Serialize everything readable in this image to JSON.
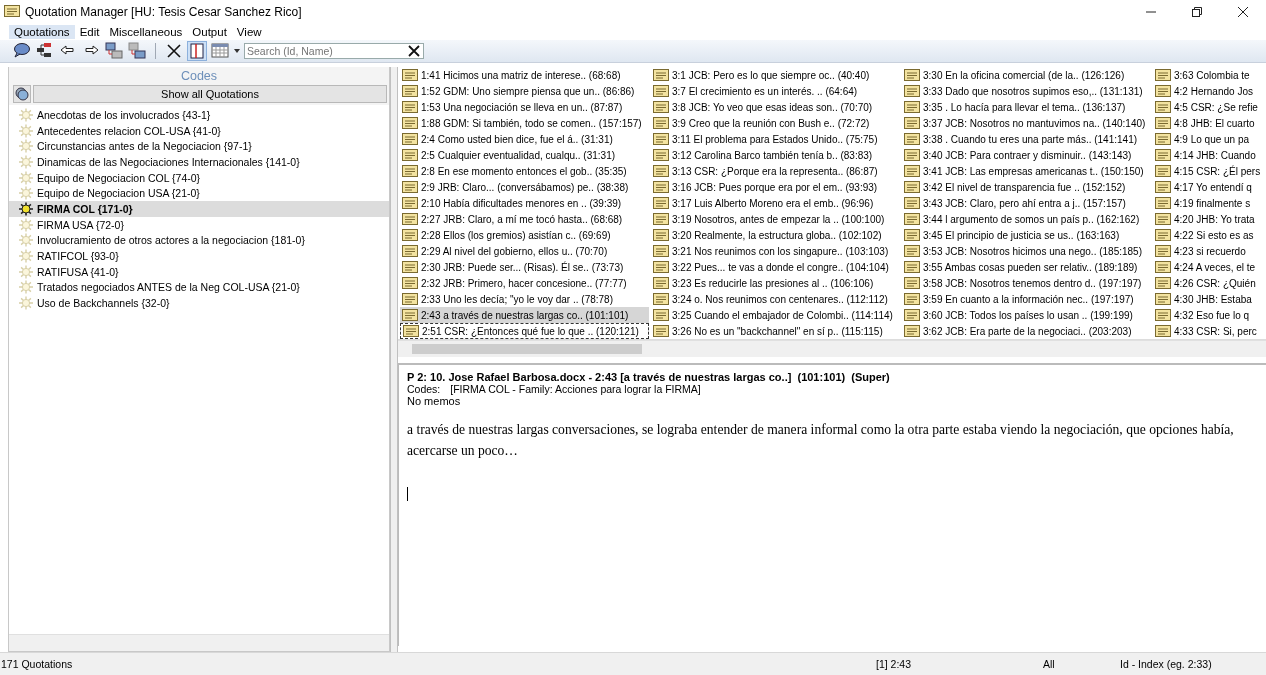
{
  "window": {
    "title": "Quotation Manager [HU: Tesis Cesar Sanchez Rico]"
  },
  "menu": [
    {
      "label": "Quotations",
      "selected": true
    },
    {
      "label": "Edit",
      "selected": false
    },
    {
      "label": "Miscellaneous",
      "selected": false
    },
    {
      "label": "Output",
      "selected": false
    },
    {
      "label": "View",
      "selected": false
    }
  ],
  "toolbar": {
    "buttons": [
      {
        "kind": "comment",
        "on": false
      },
      {
        "kind": "tree",
        "on": false
      },
      {
        "kind": "back",
        "on": false
      },
      {
        "kind": "forward",
        "on": false
      },
      {
        "kind": "window-a",
        "on": false
      },
      {
        "kind": "window-b",
        "on": false
      },
      {
        "kind": "separator"
      },
      {
        "kind": "delete",
        "on": false
      },
      {
        "kind": "columns",
        "on": true
      },
      {
        "kind": "grid",
        "on": false
      }
    ],
    "search": {
      "placeholder": "Search (Id, Name)"
    }
  },
  "codes_panel": {
    "title": "Codes",
    "show_all_button": "Show all Quotations",
    "codes": [
      {
        "label": "Anecdotas de los involucrados {43-1}",
        "selected": false
      },
      {
        "label": "Antecedentes relacion COL-USA {41-0}",
        "selected": false
      },
      {
        "label": "Circunstancias antes de la Negociacion {97-1}",
        "selected": false
      },
      {
        "label": "Dinamicas de las Negociaciones Internacionales {141-0}",
        "selected": false
      },
      {
        "label": "Equipo de Negociacion COL {74-0}",
        "selected": false
      },
      {
        "label": "Equipo de Negociacion USA {21-0}",
        "selected": false
      },
      {
        "label": "FIRMA COL {171-0}",
        "selected": true
      },
      {
        "label": "FIRMA USA {72-0}",
        "selected": false
      },
      {
        "label": "Involucramiento de otros actores a la negociacion {181-0}",
        "selected": false
      },
      {
        "label": "RATIFCOL {93-0}",
        "selected": false
      },
      {
        "label": "RATIFUSA {41-0}",
        "selected": false
      },
      {
        "label": "Tratados negociados ANTES de la Neg COL-USA {21-0}",
        "selected": false
      },
      {
        "label": "Uso de Backchannels {32-0}",
        "selected": false
      }
    ]
  },
  "quotations": {
    "columns": [
      {
        "items": [
          {
            "label": "1:41 Hicimos una matriz de interese.. (68:68)",
            "selected": false,
            "focused": false
          },
          {
            "label": "1:52 GDM: Uno siempre piensa que un.. (86:86)",
            "selected": false,
            "focused": false
          },
          {
            "label": "1:53 Una negociación se lleva en un.. (87:87)",
            "selected": false,
            "focused": false
          },
          {
            "label": "1:88 GDM: Si también, todo se comen.. (157:157)",
            "selected": false,
            "focused": false
          },
          {
            "label": "2:4 Como usted bien dice, fue el á.. (31:31)",
            "selected": false,
            "focused": false
          },
          {
            "label": "2:5 Cualquier eventualidad, cualqu.. (31:31)",
            "selected": false,
            "focused": false
          },
          {
            "label": "2:8 En ese momento entonces el gob.. (35:35)",
            "selected": false,
            "focused": false
          },
          {
            "label": "2:9 JRB: Claro... (conversábamos) pe.. (38:38)",
            "selected": false,
            "focused": false
          },
          {
            "label": "2:10 Había dificultades menores en .. (39:39)",
            "selected": false,
            "focused": false
          },
          {
            "label": "2:27 JRB: Claro, a mí me tocó hasta.. (68:68)",
            "selected": false,
            "focused": false
          },
          {
            "label": "2:28 Ellos (los gremios) asistían c.. (69:69)",
            "selected": false,
            "focused": false
          },
          {
            "label": "2:29 Al nivel del gobierno, ellos u.. (70:70)",
            "selected": false,
            "focused": false
          },
          {
            "label": "2:30 JRB: Puede ser... (Risas). Él se.. (73:73)",
            "selected": false,
            "focused": false
          },
          {
            "label": "2:32 JRB: Primero, hacer concesione.. (77:77)",
            "selected": false,
            "focused": false
          },
          {
            "label": "2:33 Uno les decía; \"yo le voy dar .. (78:78)",
            "selected": false,
            "focused": false
          },
          {
            "label": "2:43 a través de nuestras largas co.. (101:101)",
            "selected": true,
            "focused": false
          },
          {
            "label": "2:51 CSR: ¿Entonces qué fue lo que .. (120:121)",
            "selected": false,
            "focused": true
          }
        ]
      },
      {
        "items": [
          {
            "label": "3:1 JCB: Pero es lo que siempre oc.. (40:40)",
            "selected": false,
            "focused": false
          },
          {
            "label": "3:7 El crecimiento es un interés. .. (64:64)",
            "selected": false,
            "focused": false
          },
          {
            "label": "3:8 JCB: Yo veo que esas ideas son.. (70:70)",
            "selected": false,
            "focused": false
          },
          {
            "label": "3:9 Creo que la reunión con Bush e.. (72:72)",
            "selected": false,
            "focused": false
          },
          {
            "label": "3:11 El problema para Estados Unido.. (75:75)",
            "selected": false,
            "focused": false
          },
          {
            "label": "3:12 Carolina Barco también tenía b.. (83:83)",
            "selected": false,
            "focused": false
          },
          {
            "label": "3:13 CSR: ¿Porque era la representa.. (86:87)",
            "selected": false,
            "focused": false
          },
          {
            "label": "3:16 JCB: Pues porque era por el em.. (93:93)",
            "selected": false,
            "focused": false
          },
          {
            "label": "3:17 Luis Alberto Moreno era el emb.. (96:96)",
            "selected": false,
            "focused": false
          },
          {
            "label": "3:19 Nosotros, antes de empezar la .. (100:100)",
            "selected": false,
            "focused": false
          },
          {
            "label": "3:20 Realmente, la estructura globa.. (102:102)",
            "selected": false,
            "focused": false
          },
          {
            "label": "3:21 Nos reunimos con los singapure.. (103:103)",
            "selected": false,
            "focused": false
          },
          {
            "label": "3:22 Pues... te vas a donde el congre.. (104:104)",
            "selected": false,
            "focused": false
          },
          {
            "label": "3:23 Es reducirle las presiones al .. (106:106)",
            "selected": false,
            "focused": false
          },
          {
            "label": "3:24 o. Nos reunimos con centenares.. (112:112)",
            "selected": false,
            "focused": false
          },
          {
            "label": "3:25 Cuando el embajador de Colombi.. (114:114)",
            "selected": false,
            "focused": false
          },
          {
            "label": "3:26 No es un \"backchannel\" en sí p.. (115:115)",
            "selected": false,
            "focused": false
          }
        ]
      },
      {
        "items": [
          {
            "label": "3:30 En la oficina comercial (de la.. (126:126)",
            "selected": false,
            "focused": false
          },
          {
            "label": "3:33 Dado que nosotros supimos eso,.. (131:131)",
            "selected": false,
            "focused": false
          },
          {
            "label": "3:35 . Lo hacía para llevar el tema.. (136:137)",
            "selected": false,
            "focused": false
          },
          {
            "label": "3:37 JCB: Nosotros no mantuvimos na.. (140:140)",
            "selected": false,
            "focused": false
          },
          {
            "label": "3:38 . Cuando tu eres una parte más.. (141:141)",
            "selected": false,
            "focused": false
          },
          {
            "label": "3:40 JCB: Para contraer y disminuir.. (143:143)",
            "selected": false,
            "focused": false
          },
          {
            "label": "3:41 JCB: Las empresas americanas t.. (150:150)",
            "selected": false,
            "focused": false
          },
          {
            "label": "3:42 El nivel de transparencia fue .. (152:152)",
            "selected": false,
            "focused": false
          },
          {
            "label": "3:43 JCB: Claro, pero ahí entra a j.. (157:157)",
            "selected": false,
            "focused": false
          },
          {
            "label": "3:44 l argumento de somos un país p.. (162:162)",
            "selected": false,
            "focused": false
          },
          {
            "label": "3:45 El principio de justicia se us.. (163:163)",
            "selected": false,
            "focused": false
          },
          {
            "label": "3:53 JCB: Nosotros hicimos una nego.. (185:185)",
            "selected": false,
            "focused": false
          },
          {
            "label": "3:55 Ambas cosas pueden ser relativ.. (189:189)",
            "selected": false,
            "focused": false
          },
          {
            "label": "3:58 JCB: Nosotros tenemos dentro d.. (197:197)",
            "selected": false,
            "focused": false
          },
          {
            "label": "3:59 En cuanto a la información nec.. (197:197)",
            "selected": false,
            "focused": false
          },
          {
            "label": "3:60 JCB: Todos los países lo usan .. (199:199)",
            "selected": false,
            "focused": false
          },
          {
            "label": "3:62 JCB: Era parte de la negociaci.. (203:203)",
            "selected": false,
            "focused": false
          }
        ]
      },
      {
        "items": [
          {
            "label": "3:63 Colombia te",
            "selected": false,
            "focused": false
          },
          {
            "label": "4:2 Hernando Jos",
            "selected": false,
            "focused": false
          },
          {
            "label": "4:5 CSR: ¿Se refie",
            "selected": false,
            "focused": false
          },
          {
            "label": "4:8 JHB: El cuarto",
            "selected": false,
            "focused": false
          },
          {
            "label": "4:9 Lo que un pa",
            "selected": false,
            "focused": false
          },
          {
            "label": "4:14 JHB: Cuando",
            "selected": false,
            "focused": false
          },
          {
            "label": "4:15 CSR: ¿Él pers",
            "selected": false,
            "focused": false
          },
          {
            "label": "4:17 Yo entendí q",
            "selected": false,
            "focused": false
          },
          {
            "label": "4:19 finalmente s",
            "selected": false,
            "focused": false
          },
          {
            "label": "4:20 JHB: Yo trata",
            "selected": false,
            "focused": false
          },
          {
            "label": "4:22 Si esto es as",
            "selected": false,
            "focused": false
          },
          {
            "label": "4:23 si recuerdo",
            "selected": false,
            "focused": false
          },
          {
            "label": "4:24 A veces, el te",
            "selected": false,
            "focused": false
          },
          {
            "label": "4:26 CSR: ¿Quién",
            "selected": false,
            "focused": false
          },
          {
            "label": "4:30 JHB: Estaba",
            "selected": false,
            "focused": false
          },
          {
            "label": "4:32 Eso fue lo q",
            "selected": false,
            "focused": false
          },
          {
            "label": "4:33 CSR: Si, perc",
            "selected": false,
            "focused": false
          }
        ]
      }
    ]
  },
  "detail": {
    "header": "P 2: 10. Jose Rafael Barbosa.docx - 2:43 [a través de nuestras largas co..]  (101:101)  (Super)",
    "codes_label": "Codes:",
    "codes_value": "[FIRMA COL - Family: Acciones para lograr la FIRMA]",
    "memos": "No memos",
    "body": " a través de nuestras largas conversaciones, se lograba entender de manera informal como la otra parte estaba viendo la negociación, que opciones había, acercarse un poco…"
  },
  "status_bar": {
    "count": "171 Quotations",
    "current": "[1] 2:43",
    "filter": "All",
    "search_mode": "Id - Index (eg. 2:33)"
  }
}
